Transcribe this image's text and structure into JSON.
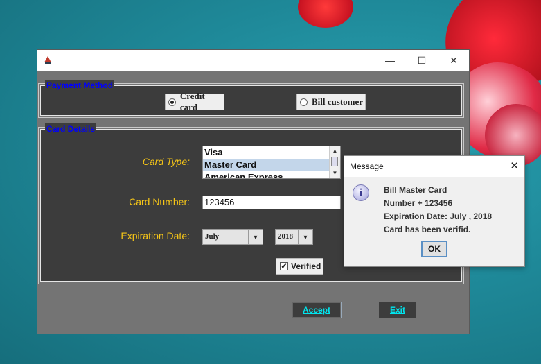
{
  "window": {
    "title": "",
    "minimize": "—",
    "maximize": "☐",
    "close": "✕"
  },
  "payment_method": {
    "title": "Payment Method",
    "options": [
      {
        "label": "Credit card",
        "selected": true
      },
      {
        "label": "Bill customer",
        "selected": false
      }
    ]
  },
  "card_details": {
    "title": "Card Details",
    "card_type_label": "Card Type:",
    "card_types": [
      "Visa",
      "Master Card",
      "American Express"
    ],
    "card_type_selected": "Master Card",
    "card_number_label": "Card Number:",
    "card_number_value": "123456",
    "expiration_label": "Expiration Date:",
    "month_value": "July",
    "year_value": "2018",
    "verified_label": "Verified",
    "verified_checked": true,
    "check_mark": "✔"
  },
  "buttons": {
    "accept": "Accept",
    "exit": "Exit"
  },
  "dialog": {
    "title": "Message",
    "close": "✕",
    "icon_glyph": "i",
    "lines": [
      "Bill Master Card",
      "Number + 123456",
      "Expiration Date: July , 2018",
      "Card has been verifid."
    ],
    "ok": "OK"
  },
  "icons": {
    "info": "info-icon",
    "dropdown": "▼"
  }
}
